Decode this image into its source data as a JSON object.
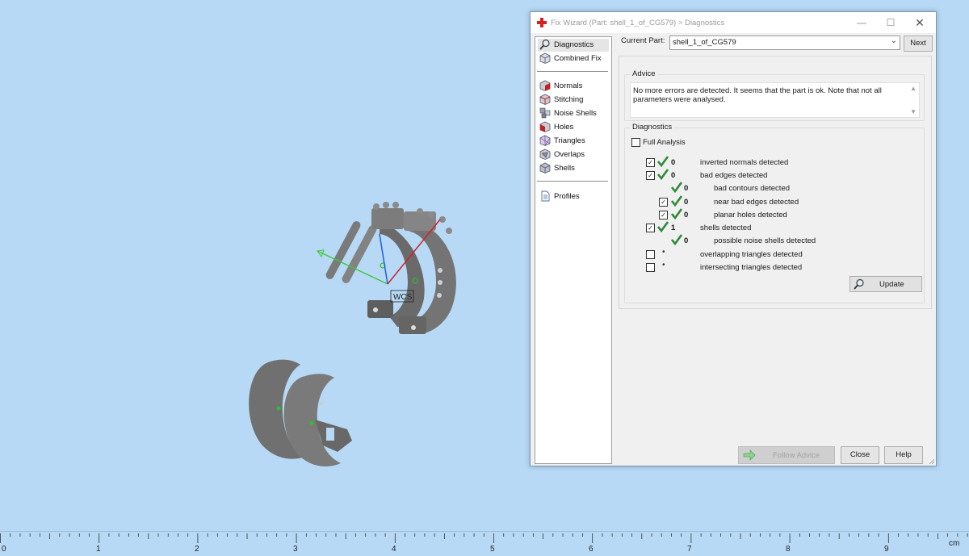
{
  "dialog": {
    "title": "Fix Wizard (Part: shell_1_of_CG579) > Diagnostics",
    "current_part_label": "Current Part:",
    "current_part_value": "shell_1_of_CG579",
    "next_label": "Next",
    "nav": {
      "top": [
        {
          "label": "Diagnostics",
          "icon": "magnifier-icon"
        },
        {
          "label": "Combined Fix",
          "icon": "cube-icon"
        }
      ],
      "tools": [
        {
          "label": "Normals",
          "icon": "normals-cube-icon"
        },
        {
          "label": "Stitching",
          "icon": "stitching-cube-icon"
        },
        {
          "label": "Noise Shells",
          "icon": "noise-shells-icon"
        },
        {
          "label": "Holes",
          "icon": "holes-cube-icon"
        },
        {
          "label": "Triangles",
          "icon": "triangles-icon"
        },
        {
          "label": "Overlaps",
          "icon": "overlaps-icon"
        },
        {
          "label": "Shells",
          "icon": "shells-icon"
        }
      ],
      "bottom": [
        {
          "label": "Profiles",
          "icon": "document-icon"
        }
      ]
    },
    "advice": {
      "title": "Advice",
      "text": "No more errors are detected. It seems that the part is ok. Note that not all parameters were analysed."
    },
    "diagnostics": {
      "title": "Diagnostics",
      "full_analysis_label": "Full Analysis",
      "full_analysis_checked": false,
      "rows": [
        {
          "checked": true,
          "has_checkbox": true,
          "status": "ok",
          "count": "0",
          "label": "inverted normals detected",
          "indent": 0
        },
        {
          "checked": true,
          "has_checkbox": true,
          "status": "ok",
          "count": "0",
          "label": "bad edges detected",
          "indent": 0
        },
        {
          "checked": false,
          "has_checkbox": false,
          "status": "ok",
          "count": "0",
          "label": "bad contours detected",
          "indent": 1
        },
        {
          "checked": true,
          "has_checkbox": true,
          "status": "ok",
          "count": "0",
          "label": "near bad edges detected",
          "indent": 1
        },
        {
          "checked": true,
          "has_checkbox": true,
          "status": "ok",
          "count": "0",
          "label": "planar holes detected",
          "indent": 1
        },
        {
          "checked": true,
          "has_checkbox": true,
          "status": "ok",
          "count": "1",
          "label": "shells detected",
          "indent": 0
        },
        {
          "checked": false,
          "has_checkbox": false,
          "status": "ok",
          "count": "0",
          "label": "possible noise shells detected",
          "indent": 1
        },
        {
          "checked": false,
          "has_checkbox": true,
          "status": "pending",
          "count": "",
          "label": "overlapping triangles detected",
          "indent": 0
        },
        {
          "checked": false,
          "has_checkbox": true,
          "status": "pending",
          "count": "",
          "label": "intersecting triangles detected",
          "indent": 0
        }
      ],
      "update_label": "Update"
    },
    "buttons": {
      "follow_advice": "Follow Advice",
      "close": "Close",
      "help": "Help"
    }
  },
  "viewport": {
    "wcs_label": "WCS",
    "background_color": "#b7d9f5",
    "part_color": "#6e6e6e"
  },
  "ruler": {
    "labels": [
      "0",
      "1",
      "2",
      "3",
      "4",
      "5",
      "6",
      "7",
      "8",
      "9"
    ],
    "unit": "cm"
  },
  "colors": {
    "check_green": "#2e8b3a",
    "accent_red": "#d32020"
  }
}
